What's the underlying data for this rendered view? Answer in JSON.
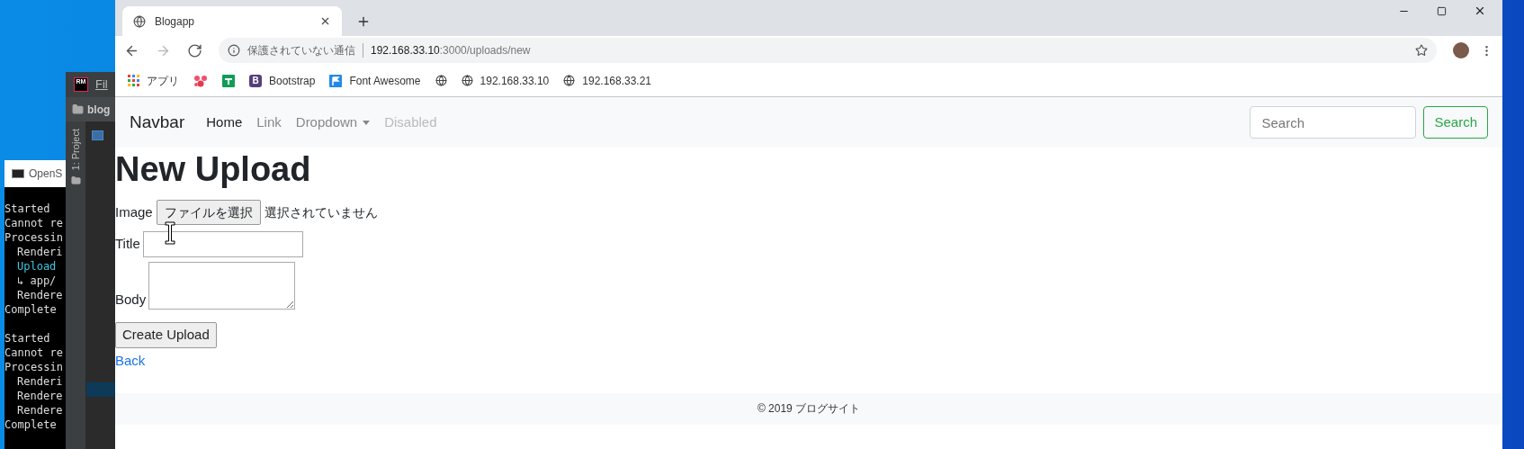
{
  "console_window": {
    "title": "OpenS",
    "lines": [
      {
        "text": "Started",
        "kind": "plain"
      },
      {
        "text": "Cannot re",
        "kind": "plain"
      },
      {
        "text": "Processin",
        "kind": "plain"
      },
      {
        "text": "Renderi",
        "kind": "indent"
      },
      {
        "text": "Upload",
        "kind": "highlight"
      },
      {
        "text": "↳ app/",
        "kind": "indent"
      },
      {
        "text": "Rendere",
        "kind": "indent"
      },
      {
        "text": "Complete",
        "kind": "plain"
      },
      {
        "kind": "blank"
      },
      {
        "text": "Started",
        "kind": "plain"
      },
      {
        "text": "Cannot re",
        "kind": "plain"
      },
      {
        "text": "Processin",
        "kind": "plain"
      },
      {
        "text": "Renderi",
        "kind": "indent"
      },
      {
        "text": "Rendere",
        "kind": "indent"
      },
      {
        "text": "Rendere",
        "kind": "indent"
      },
      {
        "text": "Complete",
        "kind": "plain"
      }
    ]
  },
  "ide_window": {
    "logo": "RM",
    "menu": "Fil",
    "project": "blog",
    "tool_tab": "1: Project"
  },
  "browser": {
    "tabs": [
      {
        "title": "Blogapp",
        "selected": true
      }
    ],
    "toolbar_buttons": [
      {
        "kind": "back",
        "disabled": false
      },
      {
        "kind": "forward",
        "disabled": true
      },
      {
        "kind": "reload",
        "disabled": false
      }
    ],
    "address": {
      "security_label": "保護されていない通信",
      "host": "192.168.33.10",
      "path": ":3000/uploads/new"
    },
    "bookmarks": [
      {
        "kind": "apps",
        "label": "アプリ"
      },
      {
        "kind": "dots"
      },
      {
        "kind": "sheet"
      },
      {
        "kind": "letter",
        "letter": "B",
        "label": "Bootstrap"
      },
      {
        "kind": "flag",
        "label": "Font Awesome"
      },
      {
        "kind": "globe"
      },
      {
        "kind": "globe",
        "label": "192.168.33.10"
      },
      {
        "kind": "globe",
        "label": "192.168.33.21"
      }
    ]
  },
  "page": {
    "navbar": {
      "brand": "Navbar",
      "links": [
        {
          "label": "Home",
          "kind": "link",
          "selected": true,
          "disabled": false
        },
        {
          "label": "Link",
          "kind": "link",
          "selected": false,
          "disabled": false
        },
        {
          "label": "Dropdown",
          "kind": "dropdown",
          "selected": false,
          "disabled": false
        },
        {
          "label": "Disabled",
          "kind": "link",
          "selected": false,
          "disabled": true
        }
      ],
      "search": {
        "placeholder": "Search",
        "button": "Search"
      }
    },
    "heading": "New Upload",
    "fields": [
      {
        "label": "Image",
        "kind": "file",
        "button": "ファイルを選択",
        "status": "選択されていません"
      },
      {
        "label": "Title",
        "kind": "text"
      },
      {
        "label": "Body",
        "kind": "textarea"
      }
    ],
    "submit": "Create Upload",
    "back_link": "Back",
    "footer": "© 2019 ブログサイト"
  }
}
